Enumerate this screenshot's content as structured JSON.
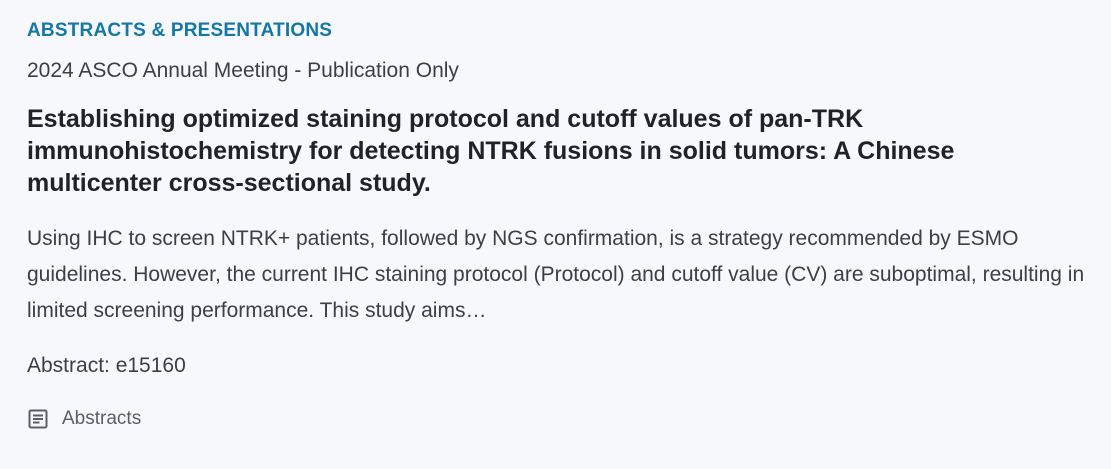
{
  "card": {
    "category": "ABSTRACTS & PRESENTATIONS",
    "meeting": "2024 ASCO Annual Meeting - Publication Only",
    "title": "Establishing optimized staining protocol and cutoff values of pan-TRK immunohistochemistry for detecting NTRK fusions in solid tumors: A Chinese multicenter cross-sectional study.",
    "summary": "Using IHC to screen NTRK+ patients, followed by NGS confirmation, is a strategy recommended by ESMO guidelines. However, the current IHC staining protocol (Protocol) and cutoff value (CV) are suboptimal, resulting in limited screening performance. This study aims…",
    "abstract_id": "Abstract: e15160",
    "tag": {
      "icon": "article-icon",
      "label": "Abstracts"
    }
  },
  "colors": {
    "category": "#1577a6",
    "title": "#1f2328",
    "body": "#3c4045",
    "background": "#f6f8fb"
  }
}
